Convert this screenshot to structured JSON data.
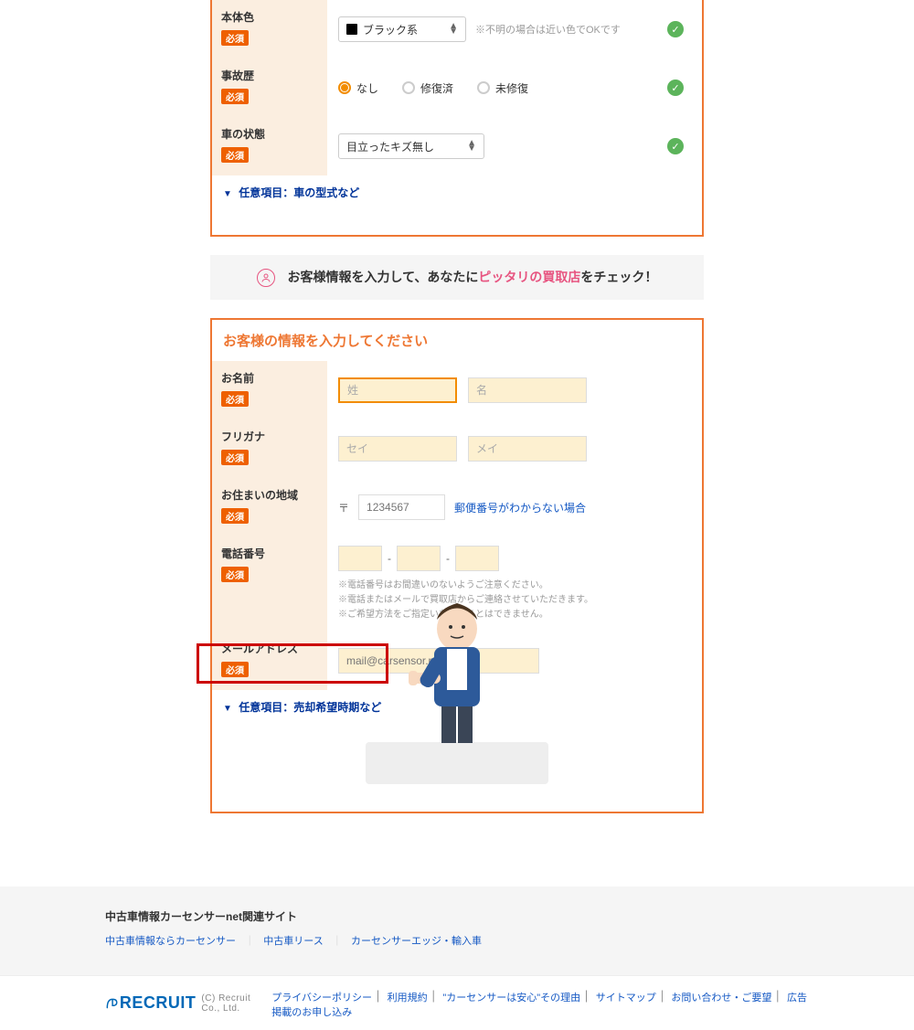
{
  "car_form": {
    "body_color": {
      "label": "本体色",
      "required": "必須",
      "value": "ブラック系",
      "helper": "※不明の場合は近い色でOKです"
    },
    "accident": {
      "label": "事故歴",
      "required": "必須",
      "options": [
        "なし",
        "修復済",
        "未修復"
      ],
      "selected": "なし"
    },
    "condition": {
      "label": "車の状態",
      "required": "必須",
      "value": "目立ったキズ無し"
    },
    "optional_link": "任意項目：車の型式など"
  },
  "banner": {
    "pre": "お客様情報を入力して、あなたに",
    "highlight": "ピッタリの買取店",
    "post": "をチェック！"
  },
  "customer_form": {
    "title": "お客様の情報を入力してください",
    "name": {
      "label": "お名前",
      "required": "必須",
      "sei_ph": "姓",
      "mei_ph": "名"
    },
    "kana": {
      "label": "フリガナ",
      "required": "必須",
      "sei_ph": "セイ",
      "mei_ph": "メイ"
    },
    "address": {
      "label": "お住まいの地域",
      "required": "必須",
      "postal_symbol": "〒",
      "postal_ph": "1234567",
      "unknown_link": "郵便番号がわからない場合"
    },
    "phone": {
      "label": "電話番号",
      "required": "必須",
      "note1": "※電話番号はお間違いのないようご注意ください。",
      "note2": "※電話またはメールで買取店からご連絡させていただきます。",
      "note3": "※ご希望方法をご指定いただくことはできません。"
    },
    "email": {
      "label": "メールアドレス",
      "required": "必須",
      "ph": "mail@carsensor.net"
    },
    "optional_link": "任意項目：売却希望時期など"
  },
  "footer": {
    "related_title": "中古車情報カーセンサーnet関連サイト",
    "links": [
      "中古車情報ならカーセンサー",
      "中古車リース",
      "カーセンサーエッジ・輸入車"
    ],
    "brand": "RECRUIT",
    "copyright": "(C) Recruit Co., Ltd.",
    "nav": [
      "プライバシーポリシー",
      "利用規約",
      "\"カーセンサーは安心\"その理由",
      "サイトマップ",
      "お問い合わせ・ご要望",
      "広告掲載のお申し込み"
    ]
  }
}
